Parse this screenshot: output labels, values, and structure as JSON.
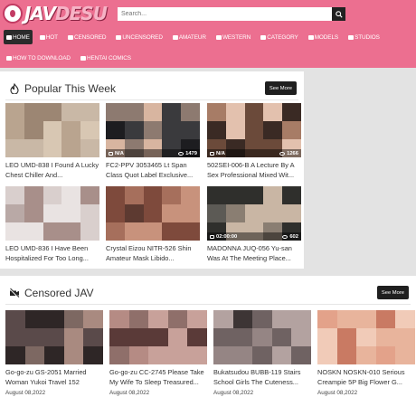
{
  "header": {
    "logo_text": "JAV",
    "logo_accent": "DESU",
    "search_placeholder": "Search...",
    "nav_row_1": [
      {
        "label": "HOME",
        "active": true,
        "icon": "home-icon"
      },
      {
        "label": "HOT",
        "active": false,
        "icon": "fire-icon"
      },
      {
        "label": "CENSORED",
        "active": false,
        "icon": "censored-icon"
      },
      {
        "label": "UNCENSORED",
        "active": false,
        "icon": "uncensored-icon"
      },
      {
        "label": "AMATEUR",
        "active": false,
        "icon": "camera-icon"
      },
      {
        "label": "WESTERN",
        "active": false,
        "icon": "western-icon"
      },
      {
        "label": "CATEGORY",
        "active": false,
        "icon": "folder-icon"
      },
      {
        "label": "MODELS",
        "active": false,
        "icon": "models-icon"
      },
      {
        "label": "STUDIOS",
        "active": false,
        "icon": "studio-icon"
      }
    ],
    "nav_row_2": [
      {
        "label": "HOW TO DOWNLOAD",
        "icon": "help-icon"
      },
      {
        "label": "HENTAI COMICS",
        "icon": "book-icon"
      }
    ]
  },
  "popular": {
    "title": "Popular This Week",
    "see_more": "See More",
    "videos": [
      {
        "title": "LEO UMD-838 I Found A Lucky Chest Chiller And...",
        "duration": "",
        "views": "",
        "colors": [
          "#b9a48f",
          "#d8c7b3",
          "#9c8673",
          "#c9b8a6"
        ]
      },
      {
        "title": "FC2-PPV 3053465 Lt Span Class Quot Label Exclusive...",
        "duration": "N/A",
        "views": "1479",
        "colors": [
          "#3a3a3d",
          "#d8b5a0",
          "#1d1d20",
          "#8d7a70"
        ]
      },
      {
        "title": "502SEI-006-B A Lecture By A Sex Professional Mixed Wit...",
        "duration": "N/A",
        "views": "1266",
        "colors": [
          "#6b4a3a",
          "#e3c1ae",
          "#a77c66",
          "#3a2a24"
        ]
      },
      {
        "title": "LEO UMD-836 I Have Been Hospitalized For Too Long...",
        "duration": "",
        "views": "",
        "colors": [
          "#d9cfcd",
          "#b9a9a6",
          "#e9e3e2",
          "#a88f8a"
        ]
      },
      {
        "title": "Crystal Eizou NITR-526 Shin Amateur Mask Libido...",
        "duration": "",
        "views": "",
        "colors": [
          "#a66f5c",
          "#5d3a31",
          "#c8927c",
          "#7e4a3c"
        ]
      },
      {
        "title": "MADONNA JUQ-056 Yu-san Was At The Meeting Place...",
        "duration": "02:00:00",
        "views": "602",
        "colors": [
          "#5c5a55",
          "#c9b6a4",
          "#2f2f2c",
          "#8a7e72"
        ]
      }
    ]
  },
  "censored": {
    "title": "Censored JAV",
    "see_more": "See More",
    "videos": [
      {
        "title": "Go-go-zu GS-2051 Married Woman Yukoi Travel 152",
        "date": "August 08,2022",
        "colors": [
          "#5a4a4a",
          "#a98a80",
          "#2e2626",
          "#7d6862"
        ]
      },
      {
        "title": "Go-go-zu CC-2745 Please Take My Wife To Sleep Treasured...",
        "date": "August 08,2022",
        "colors": [
          "#8f6f6a",
          "#c8a19a",
          "#5a3a38",
          "#b58b84"
        ]
      },
      {
        "title": "Bukatsudou BUBB-119 Stairs School Girls The Cuteness...",
        "date": "August 08,2022",
        "colors": [
          "#6f6262",
          "#b3a2a0",
          "#3d3535",
          "#958584"
        ]
      },
      {
        "title": "NOSKN NOSKN-010 Serious Creampie 5P Big Flower G...",
        "date": "August 08,2022",
        "colors": [
          "#e3a28a",
          "#f1cbb8",
          "#c97a63",
          "#e8b49c"
        ]
      }
    ]
  }
}
